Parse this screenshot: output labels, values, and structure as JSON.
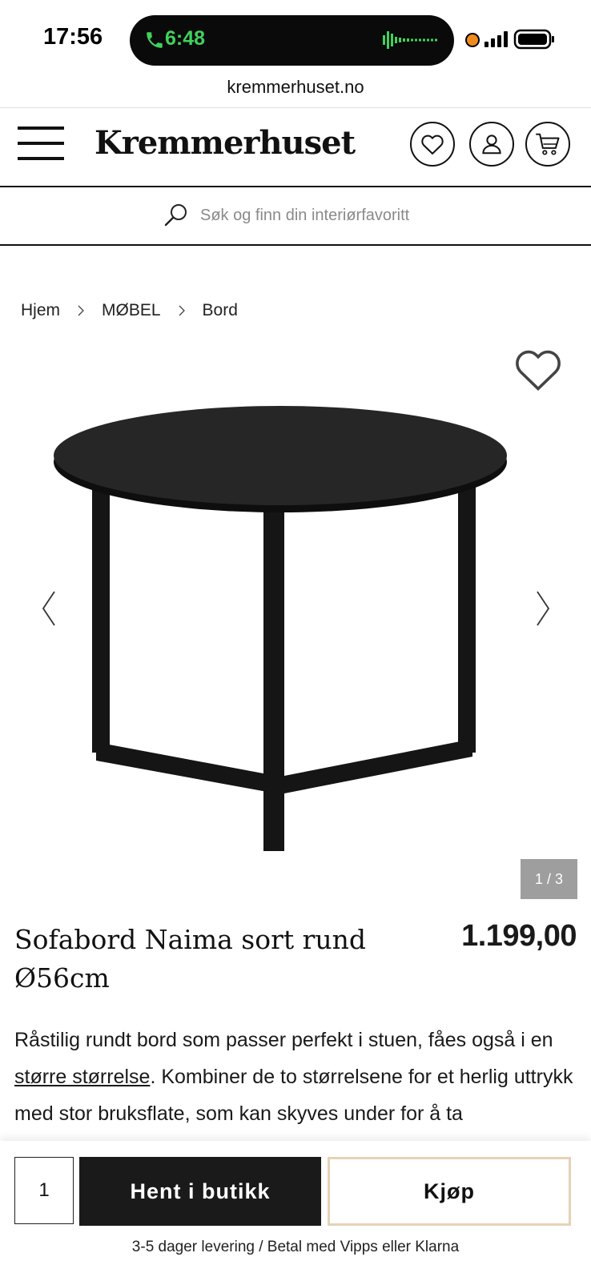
{
  "status": {
    "time": "17:56",
    "call_timer": "6:48",
    "accent": "#41d15c"
  },
  "browser": {
    "url": "kremmerhuset.no"
  },
  "header": {
    "brand": "Kremmerhuset",
    "icons": [
      "menu-icon",
      "heart-icon",
      "user-icon",
      "cart-icon"
    ]
  },
  "search": {
    "placeholder": "Søk og finn din interiørfavoritt"
  },
  "breadcrumb": [
    "Hjem",
    "MØBEL",
    "Bord"
  ],
  "gallery": {
    "counter": "1 / 3",
    "current": 1,
    "total": 3
  },
  "product": {
    "title": "Sofabord Naima sort rund Ø56cm",
    "price": "1.199,00",
    "desc_part1": "Råstilig rundt bord som passer perfekt i stuen, fåes også i en ",
    "desc_link": "større størrelse",
    "desc_part2": ". Kombiner de to størrelsene for et herlig uttrykk med stor bruksflate, som kan skyves under for å ta"
  },
  "buy_bar": {
    "quantity": "1",
    "store_button": "Hent i butikk",
    "buy_button": "Kjøp",
    "delivery_text": "3-5 dager levering / Betal med Vipps eller Klarna",
    "buy_border_color": "#e6d2b5"
  }
}
